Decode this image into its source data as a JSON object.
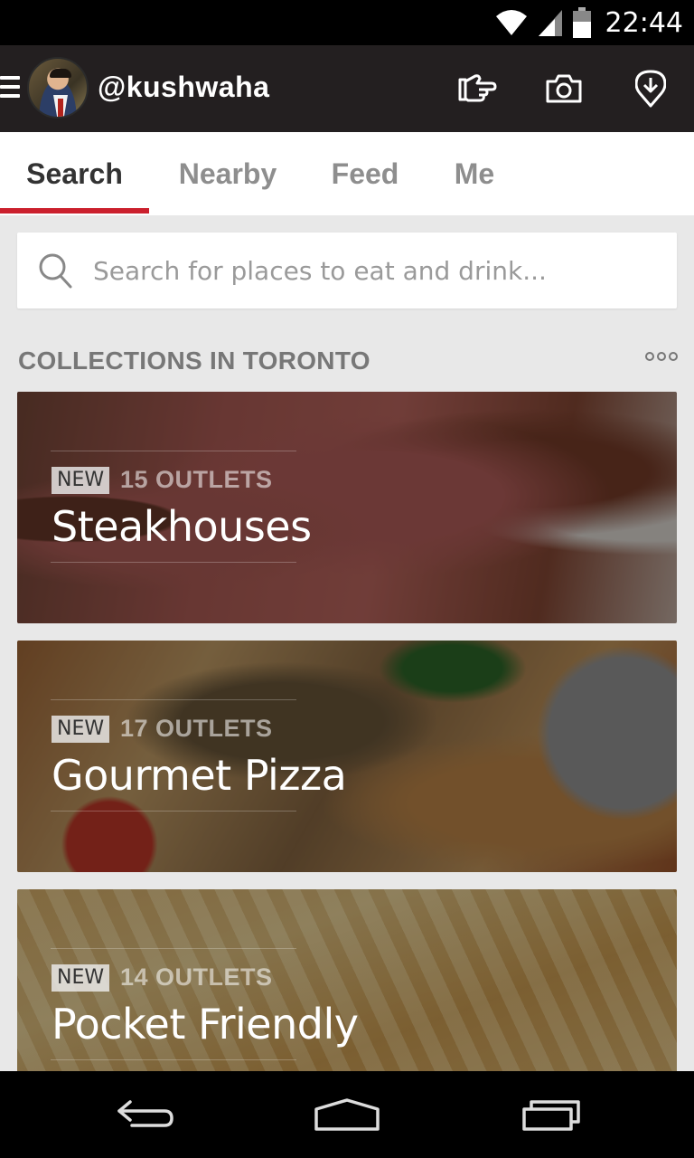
{
  "status_bar": {
    "time": "22:44"
  },
  "app_bar": {
    "username": "@kushwaha",
    "icons": [
      "hand-point-icon",
      "camera-icon",
      "location-pin-icon"
    ]
  },
  "tabs": [
    {
      "label": "Search",
      "active": true
    },
    {
      "label": "Nearby",
      "active": false
    },
    {
      "label": "Feed",
      "active": false
    },
    {
      "label": "Me",
      "active": false
    }
  ],
  "search": {
    "placeholder": "Search for places to eat and drink..."
  },
  "collections": {
    "title": "COLLECTIONS IN TORONTO",
    "items": [
      {
        "badge": "NEW",
        "outlets": "15 OUTLETS",
        "title": "Steakhouses"
      },
      {
        "badge": "NEW",
        "outlets": "17 OUTLETS",
        "title": "Gourmet Pizza"
      },
      {
        "badge": "NEW",
        "outlets": "14 OUTLETS",
        "title": "Pocket Friendly"
      }
    ]
  },
  "colors": {
    "brand_red": "#cb202d",
    "app_bar": "#231f20",
    "background": "#e8e8e8"
  }
}
